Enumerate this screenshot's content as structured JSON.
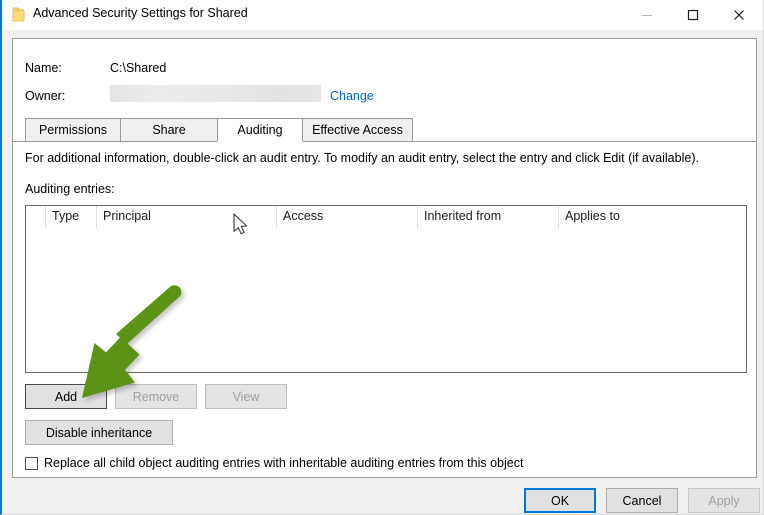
{
  "window": {
    "title": "Advanced Security Settings for Shared",
    "icon": "folder-icon",
    "accent_color": "#0078d7",
    "controls": {
      "minimize": "—",
      "maximize": "□",
      "close": "✕"
    }
  },
  "fields": {
    "name_label": "Name:",
    "name_value": "C:\\Shared",
    "owner_label": "Owner:",
    "owner_value": "",
    "change_link": "Change"
  },
  "tabs": [
    {
      "label": "Permissions",
      "active": false
    },
    {
      "label": "Share",
      "active": false
    },
    {
      "label": "Auditing",
      "active": true
    },
    {
      "label": "Effective Access",
      "active": false
    }
  ],
  "content": {
    "info_text": "For additional information, double-click an audit entry. To modify an audit entry, select the entry and click Edit (if available).",
    "entries_label": "Auditing entries:"
  },
  "listview": {
    "columns": [
      "",
      "Type",
      "Principal",
      "Access",
      "Inherited from",
      "Applies to"
    ],
    "rows": []
  },
  "buttons": {
    "add": "Add",
    "remove": "Remove",
    "view": "View",
    "disable_inheritance": "Disable inheritance"
  },
  "checkbox": {
    "label": "Replace all child object auditing entries with inheritable auditing entries from this object",
    "checked": false
  },
  "footer": {
    "ok": "OK",
    "cancel": "Cancel",
    "apply": "Apply"
  },
  "annotation": {
    "arrow_color": "#5b9213",
    "arrow_description": "green-arrow-pointing-to-add-button"
  }
}
